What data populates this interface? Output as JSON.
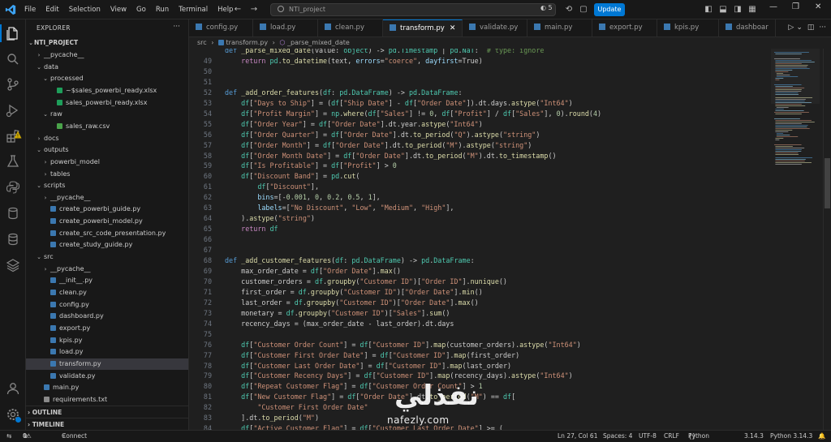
{
  "window": {
    "menu": [
      "File",
      "Edit",
      "Selection",
      "View",
      "Go",
      "Run",
      "Terminal",
      "Help"
    ],
    "search_text": "NTI_project",
    "badge_count": "5",
    "update_label": "Update"
  },
  "sidebar": {
    "title": "EXPLORER",
    "root": "NTI_PROJECT",
    "tree": [
      {
        "label": "__pycache__",
        "type": "folder",
        "depth": 1,
        "open": false
      },
      {
        "label": "data",
        "type": "folder",
        "depth": 1,
        "open": true
      },
      {
        "label": "processed",
        "type": "folder",
        "depth": 2,
        "open": true
      },
      {
        "label": "~$sales_powerbi_ready.xlsx",
        "type": "xlsx",
        "depth": 3
      },
      {
        "label": "sales_powerbi_ready.xlsx",
        "type": "xlsx",
        "depth": 3
      },
      {
        "label": "raw",
        "type": "folder",
        "depth": 2,
        "open": true
      },
      {
        "label": "sales_raw.csv",
        "type": "csv",
        "depth": 3
      },
      {
        "label": "docs",
        "type": "folder",
        "depth": 1,
        "open": false
      },
      {
        "label": "outputs",
        "type": "folder",
        "depth": 1,
        "open": true
      },
      {
        "label": "powerbi_model",
        "type": "folder",
        "depth": 2,
        "open": false
      },
      {
        "label": "tables",
        "type": "folder",
        "depth": 2,
        "open": false
      },
      {
        "label": "scripts",
        "type": "folder",
        "depth": 1,
        "open": true
      },
      {
        "label": "__pycache__",
        "type": "folder",
        "depth": 2,
        "open": false
      },
      {
        "label": "create_powerbi_guide.py",
        "type": "py",
        "depth": 2
      },
      {
        "label": "create_powerbi_model.py",
        "type": "py",
        "depth": 2
      },
      {
        "label": "create_src_code_presentation.py",
        "type": "py",
        "depth": 2
      },
      {
        "label": "create_study_guide.py",
        "type": "py",
        "depth": 2
      },
      {
        "label": "src",
        "type": "folder",
        "depth": 1,
        "open": true
      },
      {
        "label": "__pycache__",
        "type": "folder",
        "depth": 2,
        "open": false
      },
      {
        "label": "__init__.py",
        "type": "py",
        "depth": 2
      },
      {
        "label": "clean.py",
        "type": "py",
        "depth": 2
      },
      {
        "label": "config.py",
        "type": "py",
        "depth": 2
      },
      {
        "label": "dashboard.py",
        "type": "py",
        "depth": 2
      },
      {
        "label": "export.py",
        "type": "py",
        "depth": 2
      },
      {
        "label": "kpis.py",
        "type": "py",
        "depth": 2
      },
      {
        "label": "load.py",
        "type": "py",
        "depth": 2
      },
      {
        "label": "transform.py",
        "type": "py",
        "depth": 2,
        "active": true
      },
      {
        "label": "validate.py",
        "type": "py",
        "depth": 2
      },
      {
        "label": "main.py",
        "type": "py",
        "depth": 1
      },
      {
        "label": "requirements.txt",
        "type": "txt",
        "depth": 1
      }
    ],
    "outline": "OUTLINE",
    "timeline": "TIMELINE"
  },
  "tabs": [
    {
      "label": "config.py",
      "active": false
    },
    {
      "label": "load.py",
      "active": false
    },
    {
      "label": "clean.py",
      "active": false
    },
    {
      "label": "transform.py",
      "active": true
    },
    {
      "label": "validate.py",
      "active": false
    },
    {
      "label": "main.py",
      "active": false
    },
    {
      "label": "export.py",
      "active": false
    },
    {
      "label": "kpis.py",
      "active": false
    },
    {
      "label": "dashboar",
      "active": false
    }
  ],
  "breadcrumb": [
    "src",
    "transform.py",
    "_parse_mixed_date"
  ],
  "code": [
    {
      "n": "",
      "t": "def _parse_mixed_date(value: object) -> pd.Timestamp | pd.NaT:  # type: ignore"
    },
    {
      "n": "49",
      "t": "    return pd.to_datetime(text, errors=\"coerce\", dayfirst=True)"
    },
    {
      "n": "50",
      "t": ""
    },
    {
      "n": "51",
      "t": ""
    },
    {
      "n": "52",
      "t": "def _add_order_features(df: pd.DataFrame) -> pd.DataFrame:"
    },
    {
      "n": "53",
      "t": "    df[\"Days to Ship\"] = (df[\"Ship Date\"] - df[\"Order Date\"]).dt.days.astype(\"Int64\")"
    },
    {
      "n": "54",
      "t": "    df[\"Profit Margin\"] = np.where(df[\"Sales\"] != 0, df[\"Profit\"] / df[\"Sales\"], 0).round(4)"
    },
    {
      "n": "55",
      "t": "    df[\"Order Year\"] = df[\"Order Date\"].dt.year.astype(\"Int64\")"
    },
    {
      "n": "56",
      "t": "    df[\"Order Quarter\"] = df[\"Order Date\"].dt.to_period(\"Q\").astype(\"string\")"
    },
    {
      "n": "57",
      "t": "    df[\"Order Month\"] = df[\"Order Date\"].dt.to_period(\"M\").astype(\"string\")"
    },
    {
      "n": "58",
      "t": "    df[\"Order Month Date\"] = df[\"Order Date\"].dt.to_period(\"M\").dt.to_timestamp()"
    },
    {
      "n": "59",
      "t": "    df[\"Is Profitable\"] = df[\"Profit\"] > 0"
    },
    {
      "n": "60",
      "t": "    df[\"Discount Band\"] = pd.cut("
    },
    {
      "n": "61",
      "t": "        df[\"Discount\"],"
    },
    {
      "n": "62",
      "t": "        bins=[-0.001, 0, 0.2, 0.5, 1],"
    },
    {
      "n": "63",
      "t": "        labels=[\"No Discount\", \"Low\", \"Medium\", \"High\"],"
    },
    {
      "n": "64",
      "t": "    ).astype(\"string\")"
    },
    {
      "n": "65",
      "t": "    return df"
    },
    {
      "n": "66",
      "t": ""
    },
    {
      "n": "67",
      "t": ""
    },
    {
      "n": "68",
      "t": "def _add_customer_features(df: pd.DataFrame) -> pd.DataFrame:"
    },
    {
      "n": "69",
      "t": "    max_order_date = df[\"Order Date\"].max()"
    },
    {
      "n": "70",
      "t": "    customer_orders = df.groupby(\"Customer ID\")[\"Order ID\"].nunique()"
    },
    {
      "n": "71",
      "t": "    first_order = df.groupby(\"Customer ID\")[\"Order Date\"].min()"
    },
    {
      "n": "72",
      "t": "    last_order = df.groupby(\"Customer ID\")[\"Order Date\"].max()"
    },
    {
      "n": "73",
      "t": "    monetary = df.groupby(\"Customer ID\")[\"Sales\"].sum()"
    },
    {
      "n": "74",
      "t": "    recency_days = (max_order_date - last_order).dt.days"
    },
    {
      "n": "75",
      "t": ""
    },
    {
      "n": "76",
      "t": "    df[\"Customer Order Count\"] = df[\"Customer ID\"].map(customer_orders).astype(\"Int64\")"
    },
    {
      "n": "77",
      "t": "    df[\"Customer First Order Date\"] = df[\"Customer ID\"].map(first_order)"
    },
    {
      "n": "78",
      "t": "    df[\"Customer Last Order Date\"] = df[\"Customer ID\"].map(last_order)"
    },
    {
      "n": "79",
      "t": "    df[\"Customer Recency Days\"] = df[\"Customer ID\"].map(recency_days).astype(\"Int64\")"
    },
    {
      "n": "80",
      "t": "    df[\"Repeat Customer Flag\"] = df[\"Customer Order Count\"] > 1"
    },
    {
      "n": "81",
      "t": "    df[\"New Customer Flag\"] = df[\"Order Date\"].dt.to_period(\"M\") == df["
    },
    {
      "n": "82",
      "t": "        \"Customer First Order Date\""
    },
    {
      "n": "83",
      "t": "    ].dt.to_period(\"M\")"
    },
    {
      "n": "84",
      "t": "    df[\"Active Customer Flag\"] = df[\"Customer Last Order Date\"] >= ("
    }
  ],
  "status": {
    "errors": "0",
    "warnings": "0",
    "connect": "Connect",
    "position": "Ln 27, Col 61",
    "spaces": "Spaces: 4",
    "encoding": "UTF-8",
    "eol": "CRLF",
    "language": "Python",
    "version": "3.14.3",
    "interpreter": "Python 3.14.3"
  },
  "watermark": {
    "arabic": "نفذلي",
    "latin": "nafezly.com"
  },
  "colors": {
    "accent": "#0078d4",
    "keyword": "#569cd6",
    "function": "#dcdcaa",
    "string": "#ce9178",
    "number": "#b5cea8",
    "type": "#4ec9b0"
  }
}
